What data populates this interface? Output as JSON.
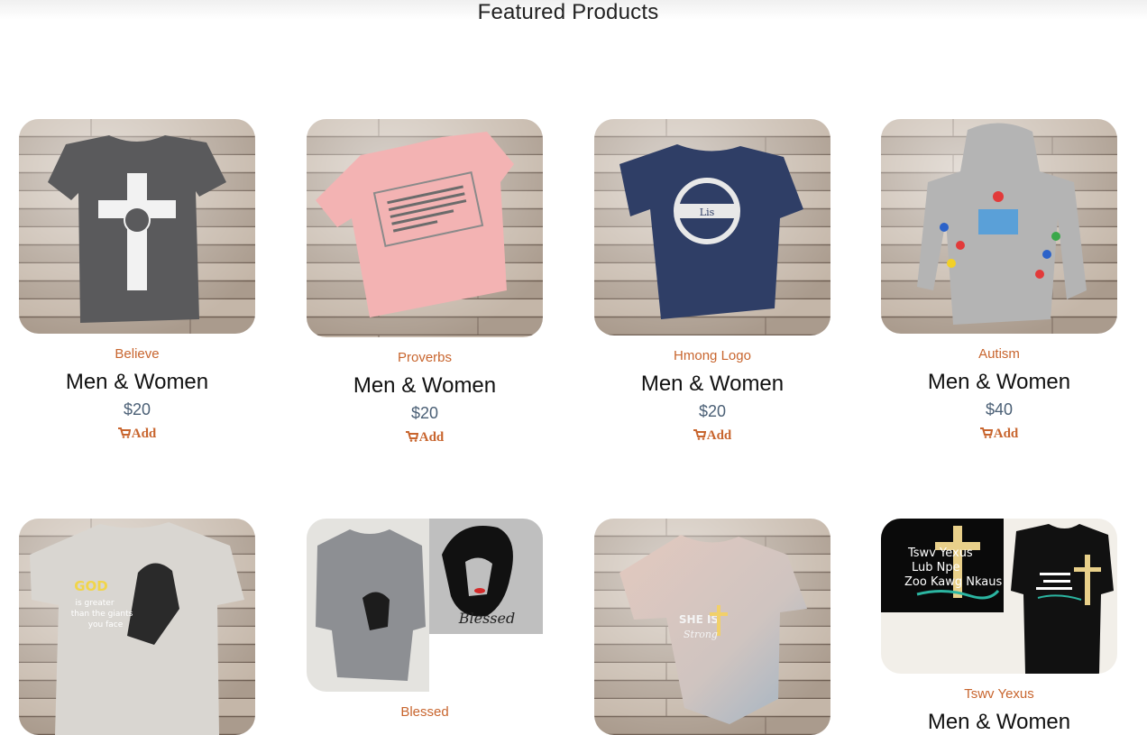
{
  "section": {
    "title": "Featured Products"
  },
  "products": [
    {
      "category": "Believe",
      "name": "Men & Women",
      "price": "$20",
      "add_label": "Add"
    },
    {
      "category": "Proverbs",
      "name": "Men & Women",
      "price": "$20",
      "add_label": "Add"
    },
    {
      "category": "Hmong Logo",
      "name": "Men & Women",
      "price": "$20",
      "add_label": "Add"
    },
    {
      "category": "Autism",
      "name": "Men & Women",
      "price": "$40",
      "add_label": "Add"
    },
    {
      "category": "",
      "name": "",
      "price": "",
      "add_label": ""
    },
    {
      "category": "Blessed",
      "name": "",
      "price": "",
      "add_label": ""
    },
    {
      "category": "",
      "name": "",
      "price": "",
      "add_label": ""
    },
    {
      "category": "Tswv Yexus",
      "name": "Men & Women",
      "price": "",
      "add_label": ""
    }
  ],
  "shirt_prints": {
    "p5": [
      "GOD",
      "is greater",
      "than the giants",
      "you face"
    ],
    "p6": [
      "Blessed"
    ],
    "p7": [
      "SHE IS",
      "Strong"
    ],
    "p8": [
      "Tswv Yexus",
      "Lub Npe",
      "Zoo Kawg Nkaus"
    ],
    "p3": [
      "Lis"
    ]
  },
  "colors": {
    "accent": "#c8652e",
    "price": "#4a5f75",
    "wood": "#b8a89a"
  }
}
